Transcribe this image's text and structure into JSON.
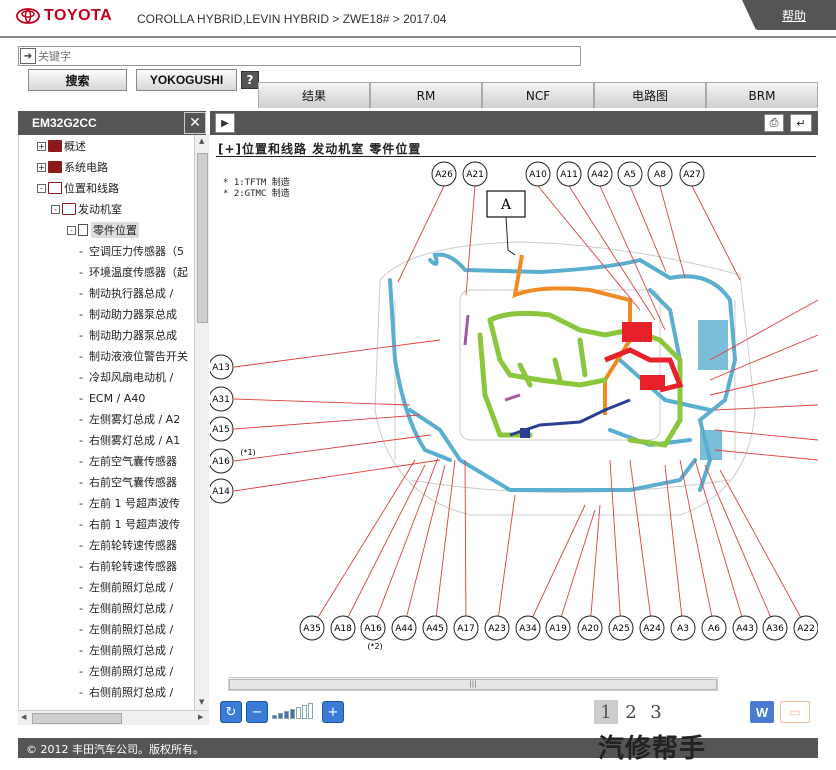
{
  "header": {
    "brand": "TOYOTA",
    "breadcrumb": "COROLLA HYBRID,LEVIN HYBRID > ZWE18# > 2017.04",
    "help_label": "帮助"
  },
  "search": {
    "placeholder": "关键字",
    "search_button": "搜索",
    "yokogushi_button": "YOKOGUSHI",
    "help_button": "?"
  },
  "tabs": [
    "结果",
    "RM",
    "NCF",
    "电路图",
    "BRM"
  ],
  "left_panel": {
    "title": "EM32G2CC",
    "tree": [
      {
        "label": "概述",
        "type": "book",
        "level": 0,
        "expander": "+"
      },
      {
        "label": "系统电路",
        "type": "book",
        "level": 0,
        "expander": "+"
      },
      {
        "label": "位置和线路",
        "type": "book-open",
        "level": 0,
        "expander": "-"
      },
      {
        "label": "发动机室",
        "type": "book-open",
        "level": 1,
        "expander": "-"
      },
      {
        "label": "零件位置",
        "type": "doc",
        "level": 2,
        "expander": "-"
      },
      {
        "label": "空调压力传感器（5",
        "type": "leaf"
      },
      {
        "label": "环境温度传感器（起",
        "type": "leaf"
      },
      {
        "label": "制动执行器总成 /",
        "type": "leaf"
      },
      {
        "label": "制动助力器泵总成",
        "type": "leaf"
      },
      {
        "label": "制动助力器泵总成",
        "type": "leaf"
      },
      {
        "label": "制动液液位警告开关",
        "type": "leaf"
      },
      {
        "label": "冷却风扇电动机 /",
        "type": "leaf"
      },
      {
        "label": "ECM / A40",
        "type": "leaf"
      },
      {
        "label": "左侧雾灯总成 / A2",
        "type": "leaf"
      },
      {
        "label": "右侧雾灯总成 / A1",
        "type": "leaf"
      },
      {
        "label": "左前空气囊传感器",
        "type": "leaf"
      },
      {
        "label": "右前空气囊传感器",
        "type": "leaf"
      },
      {
        "label": "左前 1 号超声波传",
        "type": "leaf"
      },
      {
        "label": "右前 1 号超声波传",
        "type": "leaf"
      },
      {
        "label": "左前轮转速传感器",
        "type": "leaf"
      },
      {
        "label": "右前轮转速传感器",
        "type": "leaf"
      },
      {
        "label": "左侧前照灯总成 /",
        "type": "leaf"
      },
      {
        "label": "左侧前照灯总成 /",
        "type": "leaf"
      },
      {
        "label": "左侧前照灯总成 /",
        "type": "leaf"
      },
      {
        "label": "左侧前照灯总成 /",
        "type": "leaf"
      },
      {
        "label": "左侧前照灯总成 /",
        "type": "leaf"
      },
      {
        "label": "右侧前照灯总成 /",
        "type": "leaf"
      }
    ]
  },
  "diagram": {
    "title": "[+]位置和线路  发动机室  零件位置",
    "notes": [
      "* 1:TFTM 制造",
      "* 2:GTMC 制造"
    ],
    "box_label": "A",
    "top_labels": [
      "A26",
      "A21",
      "A10",
      "A11",
      "A42",
      "A5",
      "A8",
      "A27"
    ],
    "left_labels": [
      "A13",
      "A31",
      "A15",
      "A16",
      "A14"
    ],
    "left_note": "(*1)",
    "bottom_labels": [
      "A35",
      "A18",
      "A16",
      "A44",
      "A45",
      "A17",
      "A23",
      "A34",
      "A19",
      "A20",
      "A25",
      "A24",
      "A3",
      "A6",
      "A43",
      "A36",
      "A22"
    ],
    "bottom_note": "(*2)"
  },
  "toolbar": {
    "pages": [
      "1",
      "2",
      "3"
    ],
    "current_page": "1",
    "word_button": "W",
    "comment_icon": "comment-icon",
    "zoom_level": 0.3
  },
  "footer": {
    "copyright": "© 2012 丰田汽车公司。版权所有。",
    "watermark": "汽修帮手"
  },
  "colors": {
    "header_bar": "#555555",
    "brand_red": "#c0001a",
    "harness_blue": "#5aaed0",
    "harness_green": "#8cc63f",
    "harness_orange": "#f08a24",
    "harness_red": "#e8202a",
    "callout_line": "#e04040"
  }
}
